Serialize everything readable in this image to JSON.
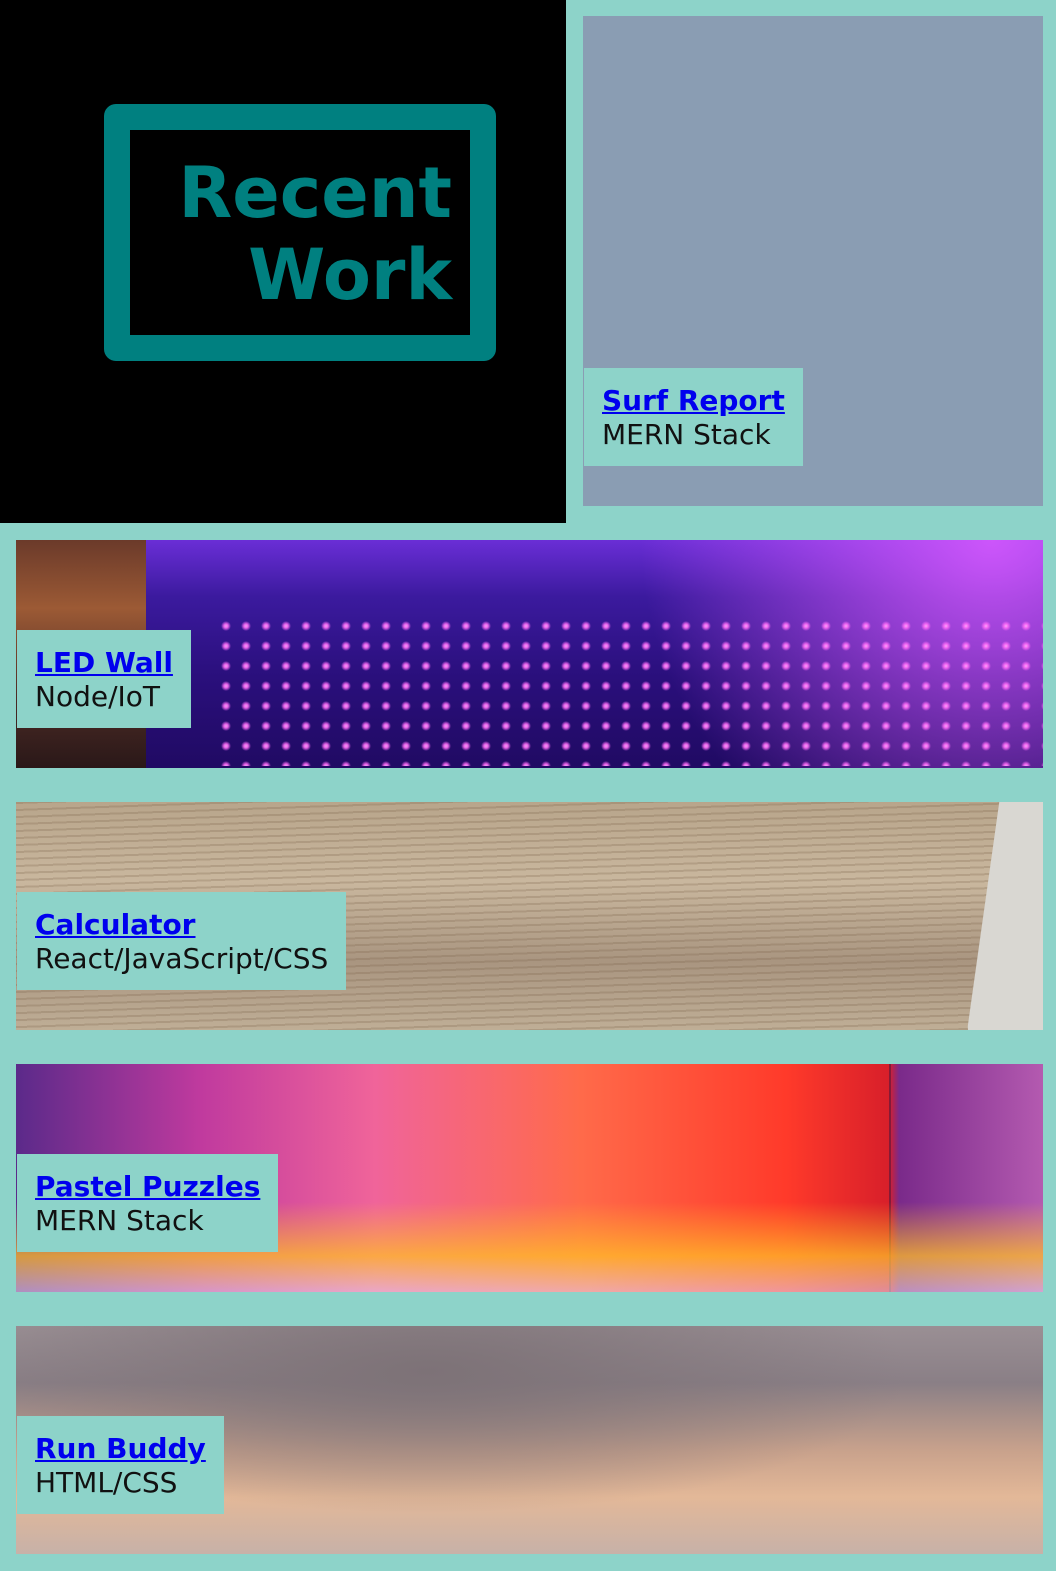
{
  "section": {
    "title_line1": "Recent",
    "title_line2": "Work"
  },
  "projects": [
    {
      "title": "Surf Report",
      "stack": "MERN Stack",
      "image": "solid-slate-blue"
    },
    {
      "title": "LED Wall",
      "stack": "Node/IoT",
      "image": "purple-led-dot-wall"
    },
    {
      "title": "Calculator",
      "stack": "React/JavaScript/CSS",
      "image": "wood-desk-with-calculator"
    },
    {
      "title": "Pastel Puzzles",
      "stack": "MERN Stack",
      "image": "pink-orange-low-poly-pattern"
    },
    {
      "title": "Run Buddy",
      "stack": "HTML/CSS",
      "image": "cloudy-sunset-sky"
    }
  ],
  "colors": {
    "background": "#8dd3c9",
    "heading_accent": "#008080",
    "link": "#0000ee"
  }
}
